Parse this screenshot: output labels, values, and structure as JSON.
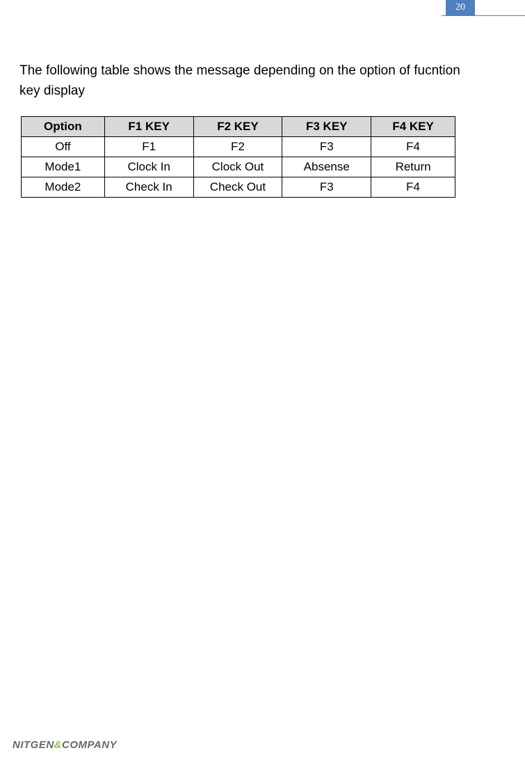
{
  "page_number": "20",
  "intro_text": "The following table shows the message depending on the option of fucntion key display",
  "table": {
    "headers": [
      "Option",
      "F1 KEY",
      "F2 KEY",
      "F3 KEY",
      "F4 KEY"
    ],
    "rows": [
      [
        "Off",
        "F1",
        "F2",
        "F3",
        "F4"
      ],
      [
        "Mode1",
        "Clock In",
        "Clock Out",
        "Absense",
        "Return"
      ],
      [
        "Mode2",
        "Check In",
        "Check Out",
        "F3",
        "F4"
      ]
    ]
  },
  "footer": {
    "part1": "NITGEN",
    "amp": "&",
    "part2": "COMPANY"
  }
}
